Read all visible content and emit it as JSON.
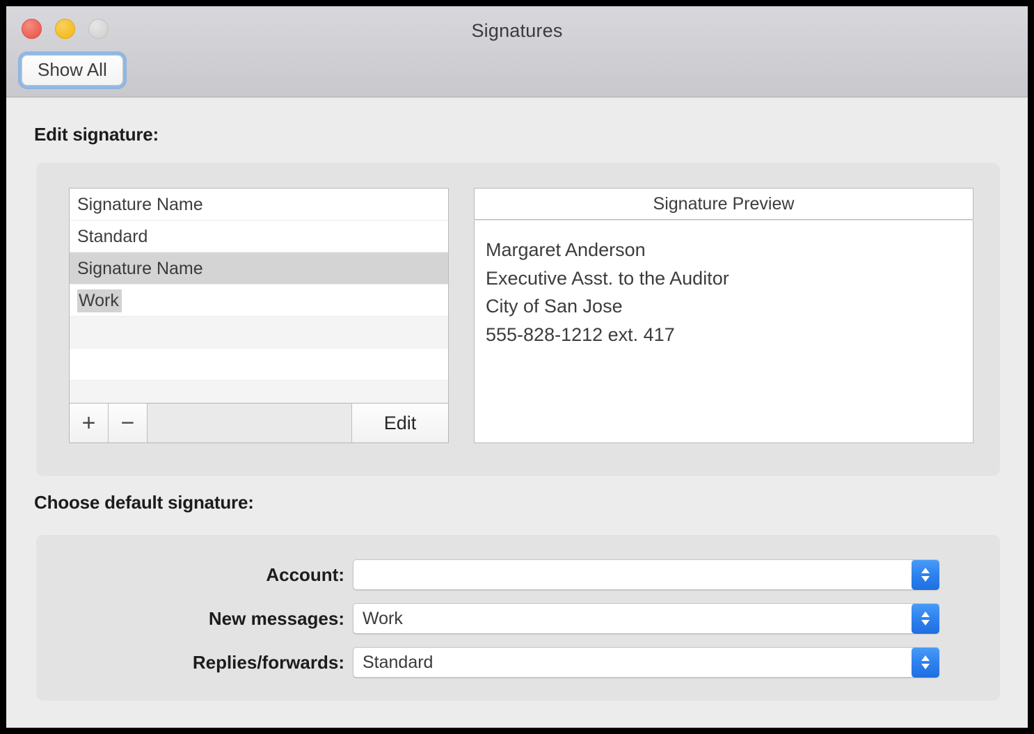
{
  "window": {
    "title": "Signatures",
    "traffic_lights": [
      {
        "name": "close",
        "color": "#ec5f54"
      },
      {
        "name": "minimize",
        "color": "#f5bd22"
      },
      {
        "name": "zoom",
        "color": "#d4d4d4"
      }
    ],
    "toolbar": {
      "show_all_label": "Show All",
      "focus_ring_color": "#8fb9e6"
    }
  },
  "sections": {
    "edit_signature": {
      "label": "Edit signature:",
      "table": {
        "rows": [
          {
            "label": "Signature Name",
            "state": "header"
          },
          {
            "label": "Standard",
            "state": "normal"
          },
          {
            "label": "Signature Name",
            "state": "selected"
          },
          {
            "label": "Work",
            "state": "editing"
          },
          {
            "label": "",
            "state": "empty-alt"
          },
          {
            "label": "",
            "state": "empty"
          },
          {
            "label": "",
            "state": "empty-alt"
          }
        ]
      },
      "footer": {
        "add_label": "+",
        "remove_label": "−",
        "edit_label": "Edit"
      },
      "preview": {
        "header": "Signature Preview",
        "lines": [
          "Margaret Anderson",
          "Executive Asst. to the Auditor",
          "City of San Jose",
          "555-828-1212 ext. 417"
        ]
      }
    },
    "choose_default": {
      "label": "Choose default signature:",
      "fields": [
        {
          "label": "Account:",
          "value": ""
        },
        {
          "label": "New messages:",
          "value": "Work"
        },
        {
          "label": "Replies/forwards:",
          "value": "Standard"
        }
      ]
    }
  },
  "colors": {
    "window_background": "#ececec",
    "groupbox_background": "#e3e3e3",
    "titlebar_background": "#d0d0d5",
    "selection_gray": "#d4d4d4",
    "popup_accent_blue": "#2e82ee"
  }
}
